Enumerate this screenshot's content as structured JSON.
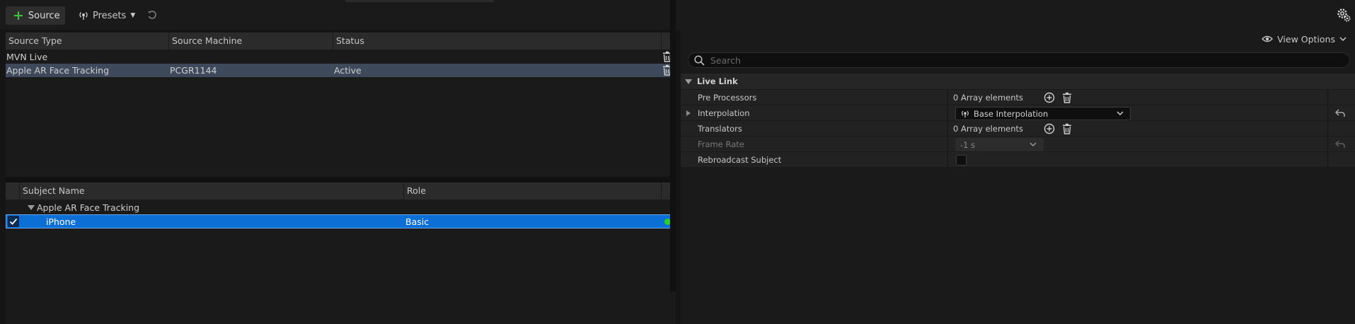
{
  "toolbar": {
    "source_label": "Source",
    "presets_label": "Presets"
  },
  "sources": {
    "columns": [
      "Source Type",
      "Source Machine",
      "Status"
    ],
    "rows": [
      {
        "type": "MVN Live",
        "machine": "",
        "status": ""
      },
      {
        "type": "Apple AR Face Tracking",
        "machine": "PCGR1144",
        "status": "Active"
      }
    ]
  },
  "subjects": {
    "columns": [
      "Subject Name",
      "Role"
    ],
    "group": "Apple AR Face Tracking",
    "rows": [
      {
        "name": "iPhone",
        "role": "Basic",
        "enabled": true
      }
    ]
  },
  "details": {
    "view_options_label": "View Options",
    "search_placeholder": "Search",
    "category": "Live Link",
    "properties": [
      {
        "name": "Pre Processors",
        "value": "0 Array elements"
      },
      {
        "name": "Interpolation",
        "value": "Base Interpolation"
      },
      {
        "name": "Translators",
        "value": "0 Array elements"
      },
      {
        "name": "Frame Rate",
        "value": "-1 s"
      },
      {
        "name": "Rebroadcast Subject",
        "value": ""
      }
    ]
  },
  "colors": {
    "selection_blue": "#0b6fd6",
    "source_selected": "#3e4a5c",
    "status_green": "#22d22a",
    "add_green": "#3fbf3f"
  }
}
